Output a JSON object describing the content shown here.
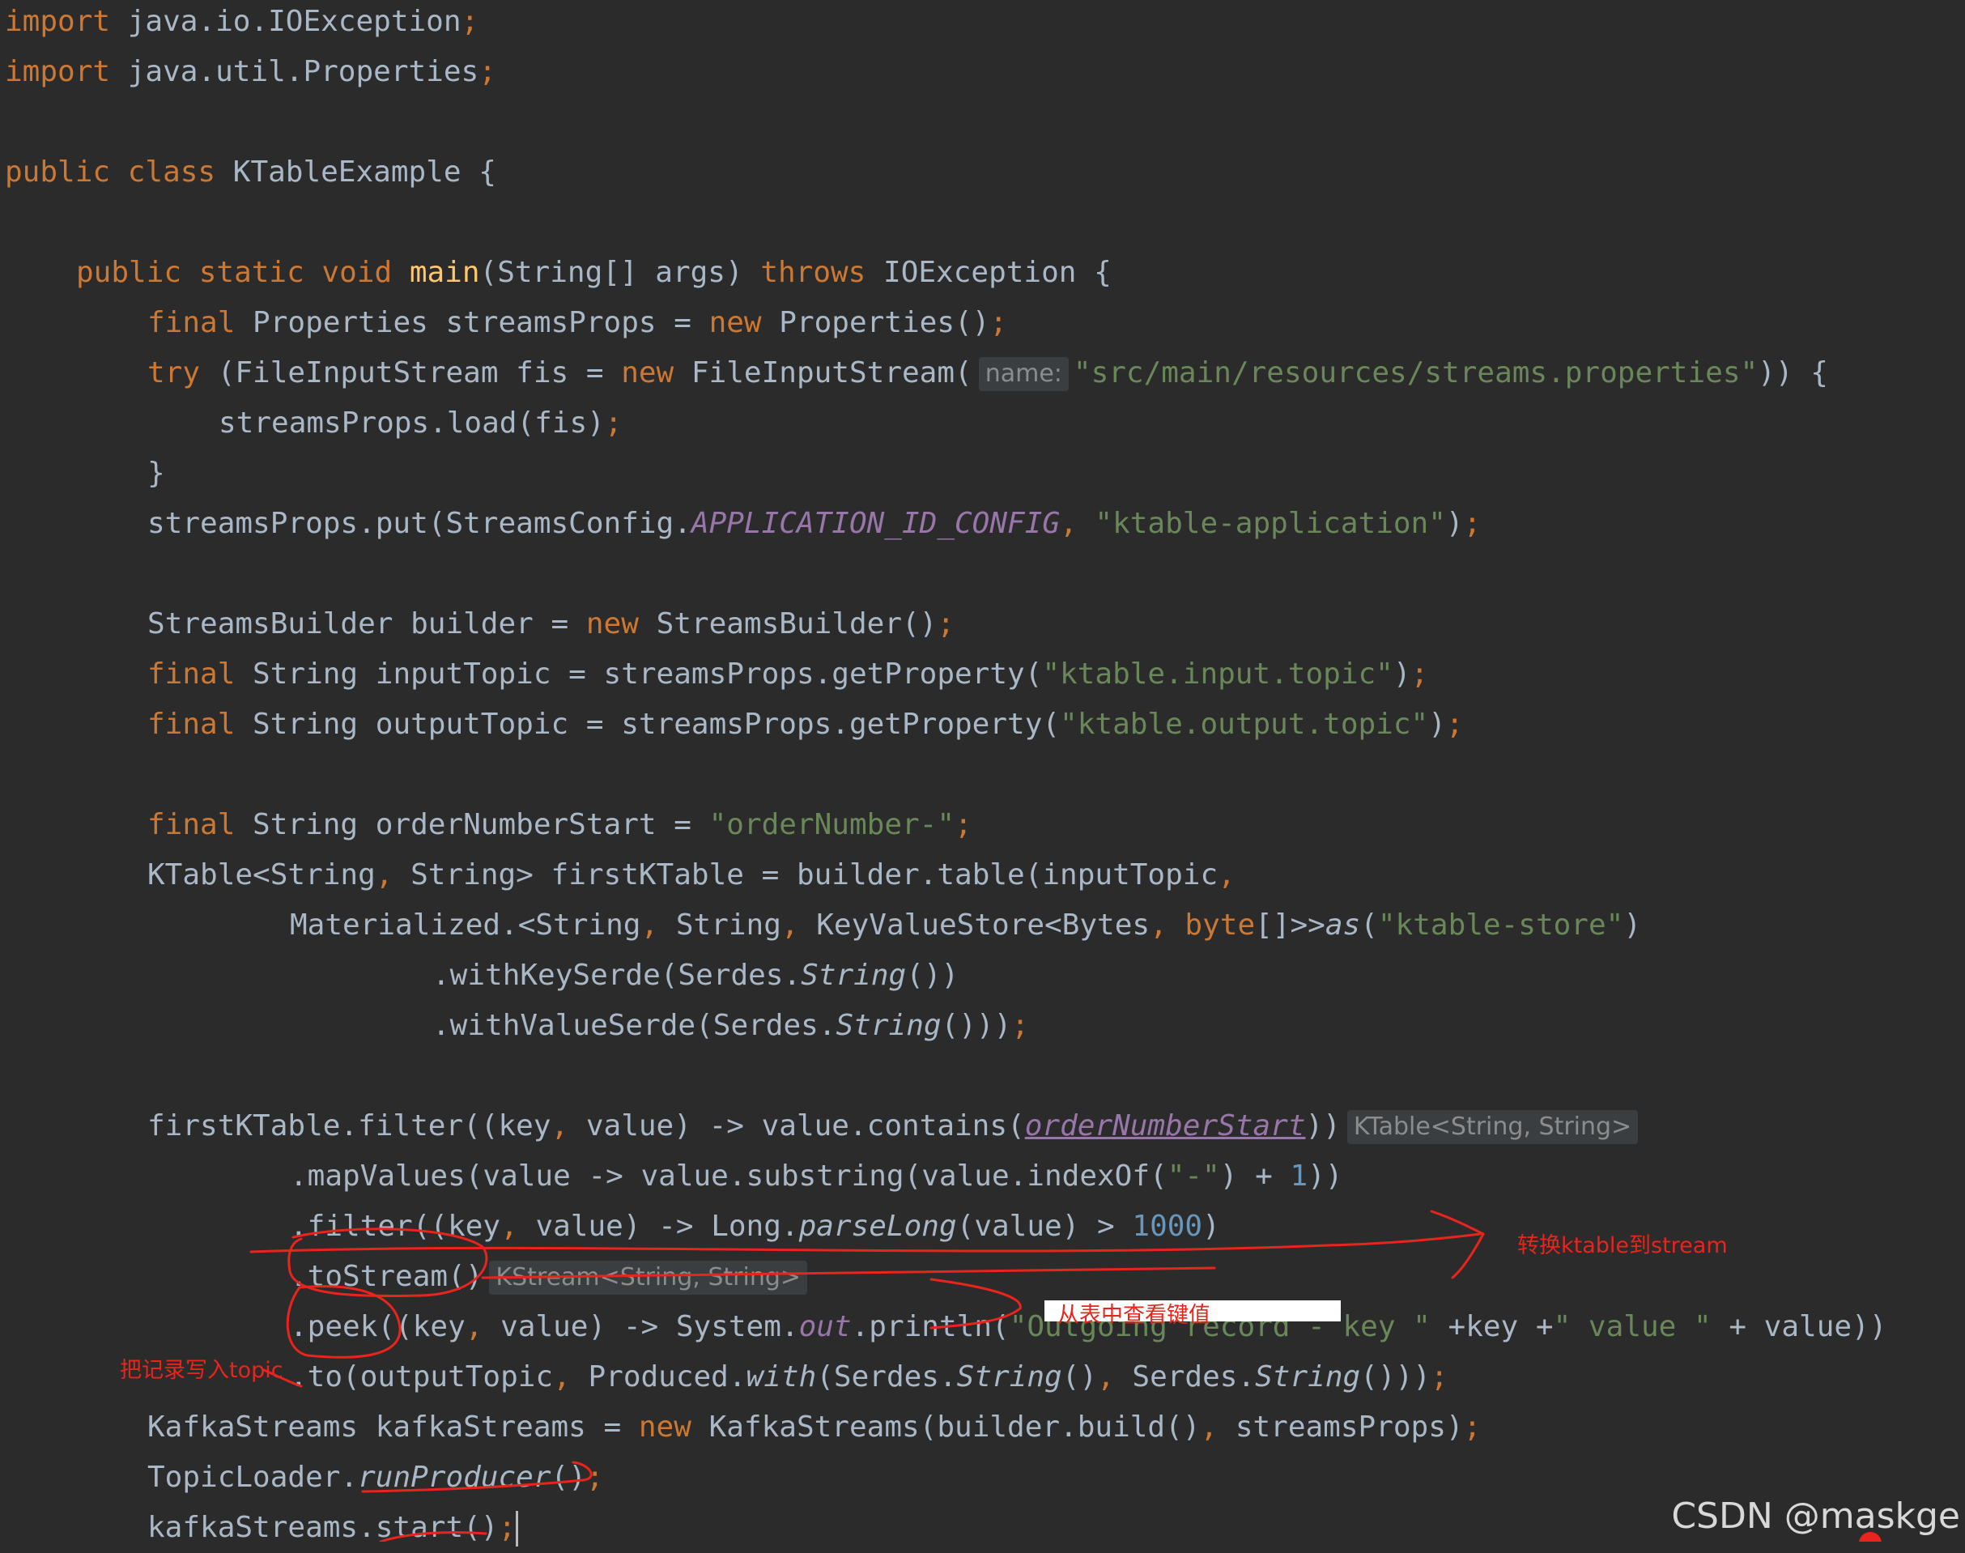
{
  "code": {
    "l1": [
      "import",
      " java.io.IOException",
      ";"
    ],
    "l2": [
      "import",
      " java.util.Properties",
      ";"
    ],
    "l3": [
      "public class",
      " KTableExample {"
    ],
    "l4": [
      "public static void",
      " ",
      "main",
      "(String[] args) ",
      "throws",
      " IOException {"
    ],
    "l5": [
      "final",
      " Properties streamsProps = ",
      "new",
      " Properties()",
      ";"
    ],
    "l6": [
      "try",
      " (FileInputStream fis = ",
      "new",
      " FileInputStream(",
      "name:",
      "\"src/main/resources/streams.properties\"",
      ")) {"
    ],
    "l7": [
      "streamsProps.load(fis)",
      ";"
    ],
    "l8": [
      "}"
    ],
    "l9": [
      "streamsProps.put(StreamsConfig.",
      "APPLICATION_ID_CONFIG",
      ", ",
      "\"ktable-application\"",
      ")",
      ";"
    ],
    "l10": [
      "StreamsBuilder builder = ",
      "new",
      " StreamsBuilder()",
      ";"
    ],
    "l11": [
      "final",
      " String inputTopic = streamsProps.getProperty(",
      "\"ktable.input.topic\"",
      ")",
      ";"
    ],
    "l12": [
      "final",
      " String outputTopic = streamsProps.getProperty(",
      "\"ktable.output.topic\"",
      ")",
      ";"
    ],
    "l13": [
      "final",
      " String orderNumberStart = ",
      "\"orderNumber-\"",
      ";"
    ],
    "l14": [
      "KTable<String",
      ", ",
      "String> firstKTable = builder.table(inputTopic",
      ","
    ],
    "l15": [
      "Materialized.<String",
      ", ",
      "String",
      ", ",
      "KeyValueStore<Bytes",
      ", ",
      "byte",
      "[]>>",
      "as",
      "(",
      "\"ktable-store\"",
      ")"
    ],
    "l16": [
      ".withKeySerde(Serdes.",
      "String",
      "())"
    ],
    "l17": [
      ".withValueSerde(Serdes.",
      "String",
      "()))",
      ";"
    ],
    "l18": [
      "firstKTable.filter((key",
      ", ",
      "value) -> value.contains(",
      "orderNumberStart",
      "))",
      "KTable<String, String>"
    ],
    "l19": [
      ".mapValues(value -> value.substring(value.indexOf(",
      "\"-\"",
      ") + ",
      "1",
      "))"
    ],
    "l20": [
      ".filter((key",
      ", ",
      "value) -> Long.",
      "parseLong",
      "(value) > ",
      "1000",
      ")"
    ],
    "l21": [
      ".toStream()",
      "KStream<String, String>"
    ],
    "l22": [
      ".peek((key",
      ", ",
      "value) -> System.",
      "out",
      ".println(",
      "\"Outgoing record - key \"",
      " +key +",
      "\" value \"",
      " + value))"
    ],
    "l23": [
      ".to(outputTopic",
      ", ",
      "Produced.",
      "with",
      "(Serdes.",
      "String",
      "()",
      ", ",
      "Serdes.",
      "String",
      "()))",
      ";"
    ],
    "l24": [
      "KafkaStreams kafkaStreams = ",
      "new",
      " KafkaStreams(builder.build()",
      ", ",
      "streamsProps)",
      ";"
    ],
    "l25": [
      "TopicLoader.",
      "runProducer",
      "()",
      ";"
    ],
    "l26": [
      "kafkaStreams.start()",
      ";"
    ]
  },
  "annotations": {
    "to_stream": "转换ktable到stream",
    "peek": "从表中查看键值",
    "to_topic": "把记录写入topic"
  },
  "watermark": "CSDN @maskge",
  "colors": {
    "background": "#2b2b2b",
    "keyword": "#cc7832",
    "string": "#6a8759",
    "constant": "#9876aa",
    "number": "#6897bb",
    "method": "#ffc66d",
    "default_text": "#a9b7c6",
    "annotation_red": "#e8241d"
  }
}
